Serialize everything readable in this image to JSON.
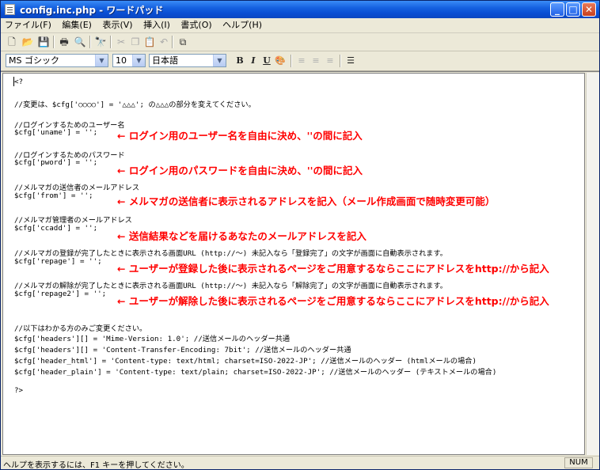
{
  "window": {
    "title": "config.inc.php - ワードパッド",
    "minimize_icon": "minimize-icon",
    "maximize_icon": "maximize-icon",
    "close_icon": "close-icon"
  },
  "menu": [
    "ファイル(F)",
    "編集(E)",
    "表示(V)",
    "挿入(I)",
    "書式(O)",
    "ヘルプ(H)"
  ],
  "toolbar": {
    "icons": [
      "new-icon",
      "open-icon",
      "save-icon",
      "print-icon",
      "print-preview-icon",
      "find-icon",
      "cut-icon",
      "copy-icon",
      "paste-icon",
      "undo-icon",
      "insert-object-icon"
    ]
  },
  "format": {
    "font": "MS ゴシック",
    "size": "10",
    "script": "日本語",
    "bold": "B",
    "italic": "I",
    "underline": "U"
  },
  "document": {
    "lines": [
      "<?",
      "//変更は、$cfg['○○○○'] = '△△△';  の△△△の部分を変えてください。",
      "//ログインするためのユーザー名",
      "$cfg['uname'] = '';",
      "//ログインするためのパスワード",
      "$cfg['pword'] = '';",
      "//メルマガの送信者のメールアドレス",
      "$cfg['from'] = '';",
      "//メルマガ管理者のメールアドレス",
      "$cfg['ccadd'] = '';",
      "//メルマガの登録が完了したときに表示される画面URL (http://～)   未記入なら「登録完了」の文字が画面に自動表示されます。",
      "$cfg['repage'] = '';",
      "//メルマガの解除が完了したときに表示される画面URL (http://～)   未記入なら「解除完了」の文字が画面に自動表示されます。",
      "$cfg['repage2'] = '';",
      "//以下はわかる方のみご変更ください。",
      "$cfg['headers'][] = 'Mime-Version: 1.0';  //送信メールのヘッダー共通",
      "$cfg['headers'][] = 'Content-Transfer-Encoding: 7bit'; //送信メールのヘッダー共通",
      "$cfg['header_html'] = 'Content-type: text/html; charset=ISO-2022-JP';  //送信メールのヘッダー (htmlメールの場合)",
      "$cfg['header_plain'] = 'Content-type: text/plain; charset=ISO-2022-JP'; //送信メールのヘッダー (テキストメールの場合)",
      "?>"
    ],
    "notes": [
      "← ログイン用のユーザー名を自由に決め、''の間に記入",
      "← ログイン用のパスワードを自由に決め、''の間に記入",
      "← メルマガの送信者に表示されるアドレスを記入（メール作成画面で随時変更可能）",
      "← 送信結果などを届けるあなたのメールアドレスを記入",
      "← ユーザーが登録した後に表示されるページをご用意するならここにアドレスをhttp://から記入",
      "← ユーザーが解除した後に表示されるページをご用意するならここにアドレスをhttp://から記入"
    ]
  },
  "status": {
    "help": "ヘルプを表示するには、F1 キーを押してください。",
    "num": "NUM"
  }
}
